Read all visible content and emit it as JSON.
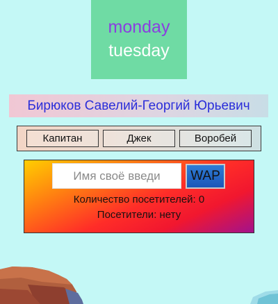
{
  "days": {
    "primary": "monday",
    "secondary": "tuesday"
  },
  "user": {
    "full_name": "Бирюков Савелий-Георгий Юрьевич"
  },
  "name_buttons": [
    "Капитан",
    "Джек",
    "Воробей"
  ],
  "visit_form": {
    "input_placeholder": "Имя своё введи",
    "input_value": "",
    "submit_label": "WAP",
    "count_text": "Количество посетителей: 0",
    "visitors_text": "Посетители: нету"
  },
  "colors": {
    "page_background": "#c4f8f6",
    "day_card": "#6fdba4",
    "day_primary_text": "#8a3ee0",
    "name_text": "#2b2ed9"
  }
}
